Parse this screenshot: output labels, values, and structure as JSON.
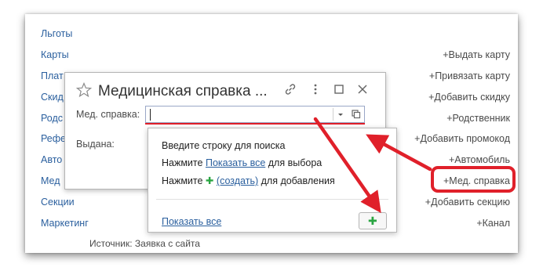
{
  "left_links": [
    "Льготы",
    "Карты",
    "Плат",
    "Скид",
    "Родс",
    "Рефе",
    "Авто",
    "Мед",
    "Секции",
    "Маркетинг"
  ],
  "right_links": [
    "+Выдать карту",
    "+Привязать карту",
    "+Добавить скидку",
    "+Родственник",
    "+Добавить промокод",
    "+Автомобиль",
    "+Мед. справка",
    "+Добавить секцию",
    "+Канал"
  ],
  "source_text": "Источник: Заявка с сайта",
  "dialog": {
    "title": "Медицинская справка ...",
    "field_label": "Мед. справка:",
    "issued_label": "Выдана:",
    "field_value": ""
  },
  "dropdown": {
    "line1": "Введите строку для поиска",
    "line2_prefix": "Нажмите",
    "line2_link": "Показать все",
    "line2_suffix": "для выбора",
    "line3_prefix": "Нажмите",
    "line3_plus": "✚",
    "line3_link": "(создать)",
    "line3_suffix": "для добавления",
    "show_all": "Показать все",
    "add_button": "✚"
  },
  "colors": {
    "link": "#2a5f9e",
    "annotation": "#e0202a",
    "create_plus": "#2aa542"
  }
}
